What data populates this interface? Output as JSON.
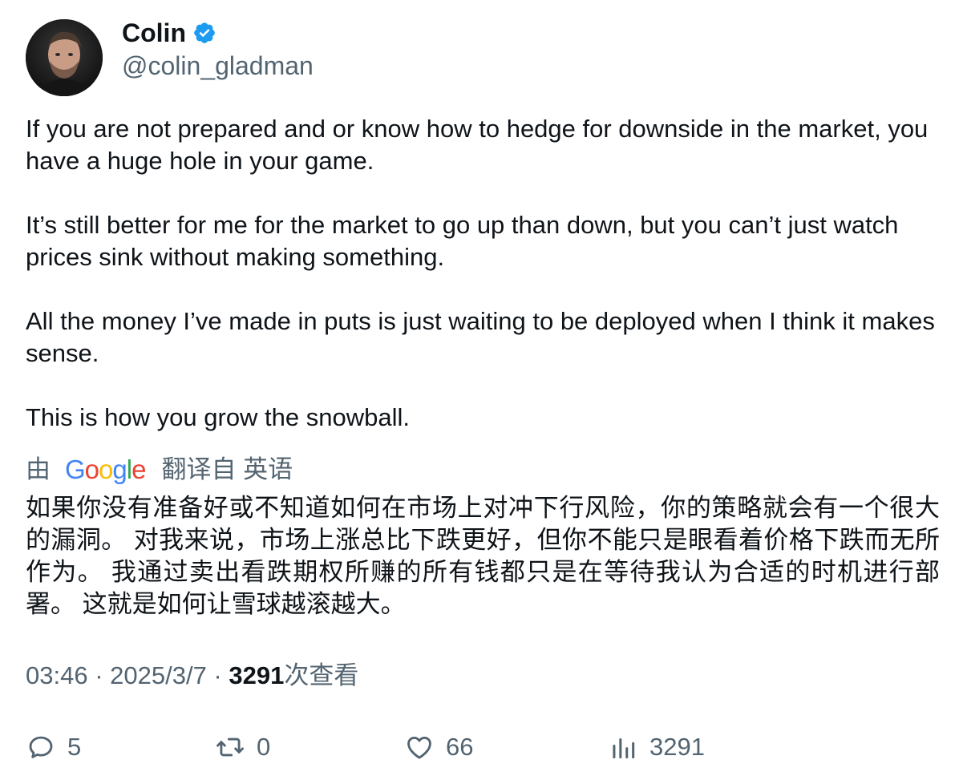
{
  "author": {
    "display_name": "Colin",
    "handle": "@colin_gladman"
  },
  "tweet": {
    "paragraphs": [
      "If you are not prepared and or know how to hedge for downside in the market, you have a huge hole in your game.",
      "It’s still better for me for the market to go up than down, but you can’t just watch prices sink without making something.",
      "All the money I’ve made in puts is just waiting to be deployed when I think it makes sense.",
      "This is how you grow the snowball."
    ]
  },
  "translation": {
    "prefix": "由",
    "provider": "Google",
    "suffix": "翻译自 英语",
    "text": "如果你没有准备好或不知道如何在市场上对冲下行风险，你的策略就会有一个很大的漏洞。 对我来说，市场上涨总比下跌更好，但你不能只是眼看着价格下跌而无所作为。 我通过卖出看跌期权所赚的所有钱都只是在等待我认为合适的时机进行部署。 这就是如何让雪球越滚越大。"
  },
  "meta": {
    "time": "03:46",
    "separator": " · ",
    "date": "2025/3/7",
    "views_count": "3291",
    "views_label": "次查看"
  },
  "actions": {
    "replies": "5",
    "retweets": "0",
    "likes": "66",
    "views": "3291"
  },
  "icons": {
    "verified": "verified-badge-icon",
    "reply": "speech-bubble-icon",
    "retweet": "retweet-arrows-icon",
    "like": "heart-icon",
    "views": "bar-chart-icon"
  },
  "colors": {
    "text_primary": "#0f1419",
    "text_secondary": "#536471",
    "verified_blue": "#1d9bf0",
    "google_blue": "#4285F4",
    "google_red": "#EA4335",
    "google_yellow": "#FBBC05",
    "google_green": "#34A853"
  }
}
